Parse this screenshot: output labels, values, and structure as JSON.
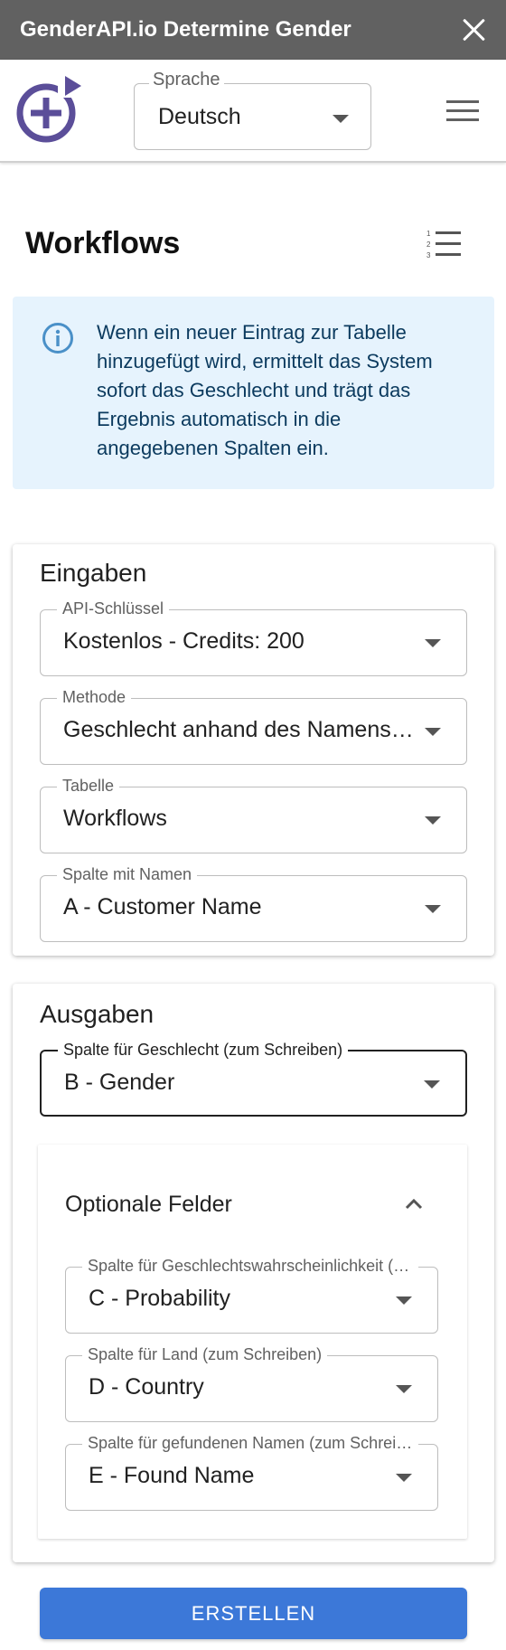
{
  "window": {
    "title": "GenderAPI.io Determine Gender"
  },
  "header": {
    "language_label": "Sprache",
    "language_value": "Deutsch"
  },
  "page": {
    "title": "Workflows"
  },
  "info": {
    "text": "Wenn ein neuer Eintrag zur Tabelle hinzugefügt wird, ermittelt das System sofort das Geschlecht und trägt das Ergebnis automatisch in die angegebenen Spalten ein."
  },
  "inputs": {
    "heading": "Eingaben",
    "api_key": {
      "label": "API-Schlüssel",
      "value": "Kostenlos - Credits: 200"
    },
    "method": {
      "label": "Methode",
      "value": "Geschlecht anhand des Namens bestimmen"
    },
    "table": {
      "label": "Tabelle",
      "value": "Workflows"
    },
    "name_column": {
      "label": "Spalte mit Namen",
      "value": "A - Customer Name"
    }
  },
  "outputs": {
    "heading": "Ausgaben",
    "gender_column": {
      "label": "Spalte für Geschlecht (zum Schreiben)",
      "value": "B - Gender"
    },
    "optional": {
      "title": "Optionale Felder",
      "probability": {
        "label": "Spalte für Geschlechtswahrscheinlichkeit (zum Schreiben)",
        "value": "C - Probability"
      },
      "country": {
        "label": "Spalte für Land (zum Schreiben)",
        "value": "D - Country"
      },
      "found_name": {
        "label": "Spalte für gefundenen Namen (zum Schreiben)",
        "value": "E - Found Name"
      }
    }
  },
  "actions": {
    "create_label": "ERSTELLEN"
  },
  "colors": {
    "titlebar": "#616161",
    "accent": "#3c78d8",
    "logo": "#5b4e99",
    "info_bg": "#e6f3fd",
    "info_icon": "#4a90c8"
  }
}
